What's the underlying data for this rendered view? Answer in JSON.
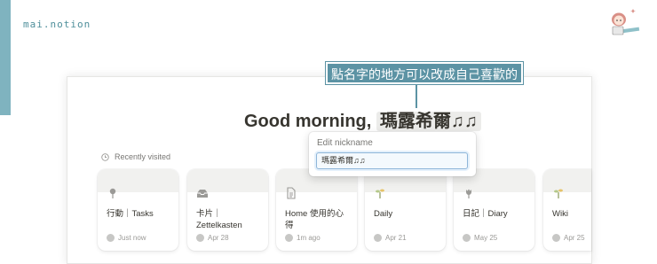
{
  "brand": "mai.notion",
  "callout": "點名字的地方可以改成自己喜歡的",
  "greeting": {
    "prefix": "Good morning, ",
    "name": "瑪露希爾♫♫"
  },
  "edit_nickname": {
    "label": "Edit nickname",
    "value": "瑪露希爾♫♫"
  },
  "recently_visited": {
    "heading": "Recently visited",
    "items": [
      {
        "title": "行動｜Tasks",
        "time": "Just now",
        "icon": "pin-icon"
      },
      {
        "title": "卡片｜Zettelkasten",
        "time": "Apr 28",
        "icon": "inbox-icon"
      },
      {
        "title": "Home 使用的心得",
        "time": "1m ago",
        "icon": "document-icon"
      },
      {
        "title": "Daily",
        "time": "Apr 21",
        "icon": "sprout-icon"
      },
      {
        "title": "日記｜Diary",
        "time": "May 25",
        "icon": "tulip-icon"
      },
      {
        "title": "Wiki",
        "time": "Apr 25",
        "icon": "sprout-icon"
      }
    ]
  },
  "colors": {
    "accent": "#5c93a4",
    "sidebar_strip": "#7fb3bf",
    "text": "#37352f",
    "muted": "#787774"
  }
}
